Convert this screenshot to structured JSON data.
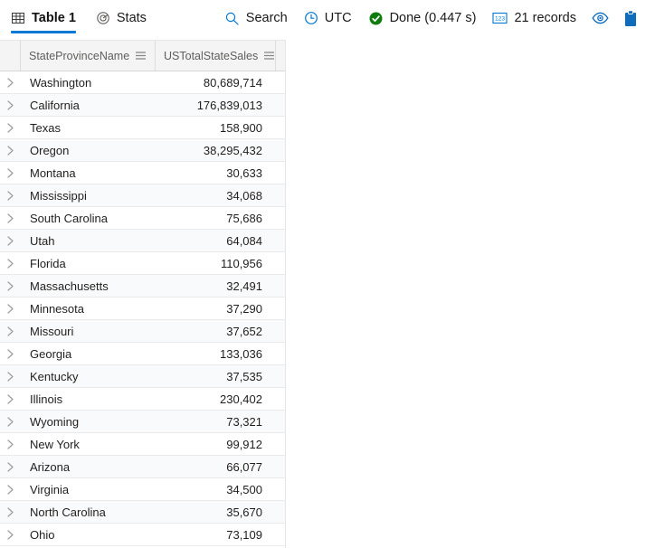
{
  "toolbar": {
    "tabs": [
      {
        "label": "Table 1",
        "icon": "table-icon",
        "active": true
      },
      {
        "label": "Stats",
        "icon": "stats-icon",
        "active": false
      }
    ],
    "search_label": "Search",
    "search_icon": "search-icon",
    "timezone_label": "UTC",
    "timezone_icon": "clock-icon",
    "status_label": "Done (0.447 s)",
    "status_icon": "success-check-icon",
    "status_color": "#107c10",
    "records_label": "21 records",
    "records_icon": "numeric-123-icon",
    "preview_icon": "eye-icon",
    "copy_icon": "clipboard-icon",
    "accent_color": "#0078d4"
  },
  "grid": {
    "expand_icon": "chevron-right-icon",
    "menu_icon": "column-menu-icon",
    "columns": [
      {
        "label": "StateProvinceName"
      },
      {
        "label": "USTotalStateSales"
      }
    ],
    "rows": [
      {
        "state": "Washington",
        "sales": "80,689,714"
      },
      {
        "state": "California",
        "sales": "176,839,013"
      },
      {
        "state": "Texas",
        "sales": "158,900"
      },
      {
        "state": "Oregon",
        "sales": "38,295,432"
      },
      {
        "state": "Montana",
        "sales": "30,633"
      },
      {
        "state": "Mississippi",
        "sales": "34,068"
      },
      {
        "state": "South Carolina",
        "sales": "75,686"
      },
      {
        "state": "Utah",
        "sales": "64,084"
      },
      {
        "state": "Florida",
        "sales": "110,956"
      },
      {
        "state": "Massachusetts",
        "sales": "32,491"
      },
      {
        "state": "Minnesota",
        "sales": "37,290"
      },
      {
        "state": "Missouri",
        "sales": "37,652"
      },
      {
        "state": "Georgia",
        "sales": "133,036"
      },
      {
        "state": "Kentucky",
        "sales": "37,535"
      },
      {
        "state": "Illinois",
        "sales": "230,402"
      },
      {
        "state": "Wyoming",
        "sales": "73,321"
      },
      {
        "state": "New York",
        "sales": "99,912"
      },
      {
        "state": "Arizona",
        "sales": "66,077"
      },
      {
        "state": "Virginia",
        "sales": "34,500"
      },
      {
        "state": "North Carolina",
        "sales": "35,670"
      },
      {
        "state": "Ohio",
        "sales": "73,109"
      }
    ]
  }
}
